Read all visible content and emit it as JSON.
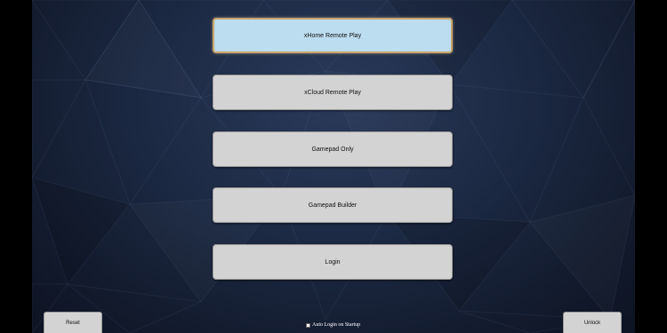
{
  "menu": {
    "items": [
      {
        "label": "xHome Remote Play",
        "selected": true
      },
      {
        "label": "xCloud Remote Play",
        "selected": false
      },
      {
        "label": "Gamepad Only",
        "selected": false
      },
      {
        "label": "Gamepad Builder",
        "selected": false
      },
      {
        "label": "Login",
        "selected": false
      }
    ]
  },
  "footer": {
    "reset_label": "Reset",
    "unlock_label": "Unlock",
    "auto_login_label": "Auto Login on Startup",
    "auto_login_checked": false
  },
  "colors": {
    "background": "#1c2943",
    "button": "#d3d3d3",
    "button_selected": "#bcdcf0",
    "selected_border": "#c9a46a"
  }
}
